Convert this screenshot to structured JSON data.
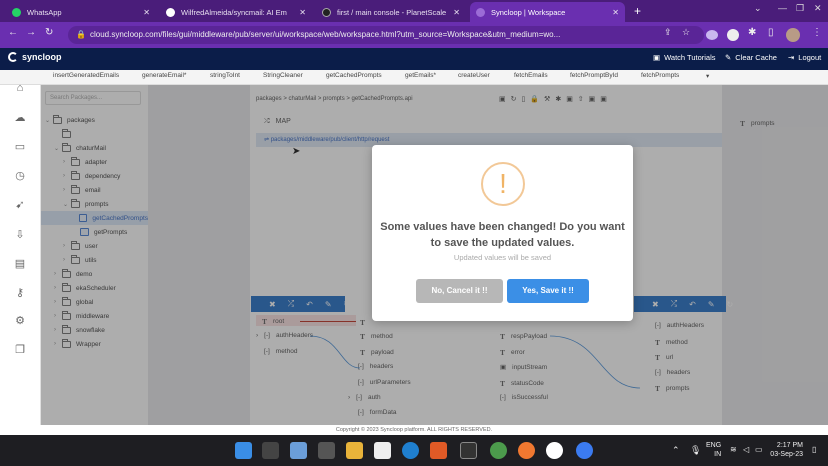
{
  "browser": {
    "tabs": [
      {
        "title": "WhatsApp",
        "color": "#25d366"
      },
      {
        "title": "WilfredAlmeida/syncmail: AI Em",
        "color": "#ffffff"
      },
      {
        "title": "first / main console - PlanetScale",
        "color": "#222222"
      },
      {
        "title": "Syncloop | Workspace",
        "color": "#9b6bd6"
      }
    ],
    "new_tab": "+",
    "url": "cloud.syncloop.com/files/gui/middleware/pub/server/ui/workspace/web/workspace.html?utm_source=Workspace&utm_medium=wo..."
  },
  "app": {
    "logo_text": "syncloop",
    "watch_tutorials": "Watch Tutorials",
    "clear_cache": "Clear Cache",
    "logout": "Logout"
  },
  "editor_tabs": [
    "insertGeneratedEmails",
    "generateEmail*",
    "stringToInt",
    "StringCleaner",
    "getCachedPrompts",
    "getEmails*",
    "createUser",
    "fetchEmails",
    "fetchPromptById",
    "fetchPrompts"
  ],
  "tree": {
    "search_placeholder": "Search Packages...",
    "nodes": [
      {
        "label": "packages",
        "indent": 0,
        "chev": "⌄",
        "type": "folder"
      },
      {
        "label": "",
        "indent": 1,
        "chev": "",
        "type": "box"
      },
      {
        "label": "chaturMail",
        "indent": 1,
        "chev": "⌄",
        "type": "folder"
      },
      {
        "label": "adapter",
        "indent": 2,
        "chev": "›",
        "type": "folder"
      },
      {
        "label": "dependency",
        "indent": 2,
        "chev": "›",
        "type": "folder"
      },
      {
        "label": "email",
        "indent": 2,
        "chev": "›",
        "type": "folder"
      },
      {
        "label": "prompts",
        "indent": 2,
        "chev": "⌄",
        "type": "folder"
      },
      {
        "label": "getCachedPrompts",
        "indent": 3,
        "chev": "",
        "type": "file",
        "selected": true
      },
      {
        "label": "getPrompts",
        "indent": 3,
        "chev": "",
        "type": "file"
      },
      {
        "label": "user",
        "indent": 2,
        "chev": "›",
        "type": "folder"
      },
      {
        "label": "utils",
        "indent": 2,
        "chev": "›",
        "type": "folder"
      },
      {
        "label": "demo",
        "indent": 1,
        "chev": "›",
        "type": "folder"
      },
      {
        "label": "ekaScheduler",
        "indent": 1,
        "chev": "›",
        "type": "folder"
      },
      {
        "label": "global",
        "indent": 1,
        "chev": "›",
        "type": "folder"
      },
      {
        "label": "middleware",
        "indent": 1,
        "chev": "›",
        "type": "folder"
      },
      {
        "label": "snowflake",
        "indent": 1,
        "chev": "›",
        "type": "folder"
      },
      {
        "label": "Wrapper",
        "indent": 1,
        "chev": "›",
        "type": "folder"
      }
    ]
  },
  "workspace": {
    "breadcrumb": "packages > chaturMail > prompts > getCachedPrompts.api",
    "map_label": "MAP",
    "map_path": "packages/middleware/pub/client/http/request",
    "right_field": "prompts",
    "left_fields": [
      "root",
      "authHeaders",
      "method"
    ],
    "mid_fields": [
      "method",
      "payload",
      "headers",
      "urlParameters",
      "auth",
      "formData"
    ],
    "mid2_fields": [
      "respPayload",
      "error",
      "inputStream",
      "statusCode",
      "isSuccessful"
    ],
    "right_fields": [
      "authHeaders",
      "method",
      "url",
      "headers",
      "prompts"
    ]
  },
  "modal": {
    "icon": "!",
    "title": "Some values have been changed! Do you want to save the updated values.",
    "subtitle": "Updated values will be saved",
    "cancel_label": "No, Cancel it !!",
    "confirm_label": "Yes, Save it !!",
    "cancel_color": "#b7b7b7",
    "confirm_color": "#3b8fe6"
  },
  "footer": "Copyright © 2023 Syncloop platform. ALL RIGHTS RESERVED.",
  "taskbar": {
    "time": "2:17 PM",
    "date": "03-Sep-23",
    "lang": "ENG",
    "region": "IN"
  }
}
